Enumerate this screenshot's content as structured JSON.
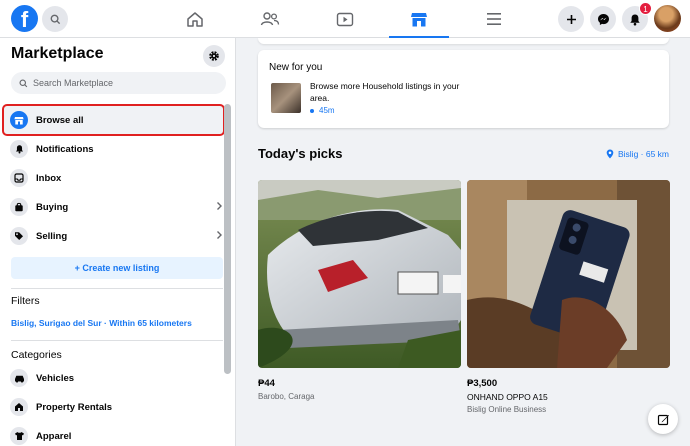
{
  "nav": {
    "logo": "f",
    "tabs": [
      "home-icon",
      "friends-icon",
      "watch-icon",
      "marketplace-icon",
      "menu-icon"
    ],
    "notification_count": "1"
  },
  "sidebar": {
    "title": "Marketplace",
    "search_placeholder": "Search Marketplace",
    "items": [
      {
        "label": "Browse all",
        "icon": "storefront-icon"
      },
      {
        "label": "Notifications",
        "icon": "bell-icon"
      },
      {
        "label": "Inbox",
        "icon": "inbox-icon"
      },
      {
        "label": "Buying",
        "icon": "bag-icon"
      },
      {
        "label": "Selling",
        "icon": "tag-icon"
      }
    ],
    "create_listing": "+ Create new listing",
    "filters_heading": "Filters",
    "filter_location": "Bislig, Surigao del Sur · Within 65 kilometers",
    "categories_heading": "Categories",
    "categories": [
      {
        "label": "Vehicles",
        "icon": "car-icon"
      },
      {
        "label": "Property Rentals",
        "icon": "house-icon"
      },
      {
        "label": "Apparel",
        "icon": "shirt-icon"
      }
    ]
  },
  "new_for_you": {
    "title": "New for you",
    "text": "Browse more Household listings in your area.",
    "time": "45m"
  },
  "picks": {
    "title": "Today's picks",
    "location": "Bislig · 65 km",
    "listings": [
      {
        "price": "₱44",
        "title": "",
        "location": "Barobo, Caraga"
      },
      {
        "price": "₱3,500",
        "title": "ONHAND OPPO A15",
        "location": "Bislig Online Business"
      }
    ]
  },
  "colors": {
    "accent": "#1877f2",
    "highlight_border": "#e02020"
  }
}
